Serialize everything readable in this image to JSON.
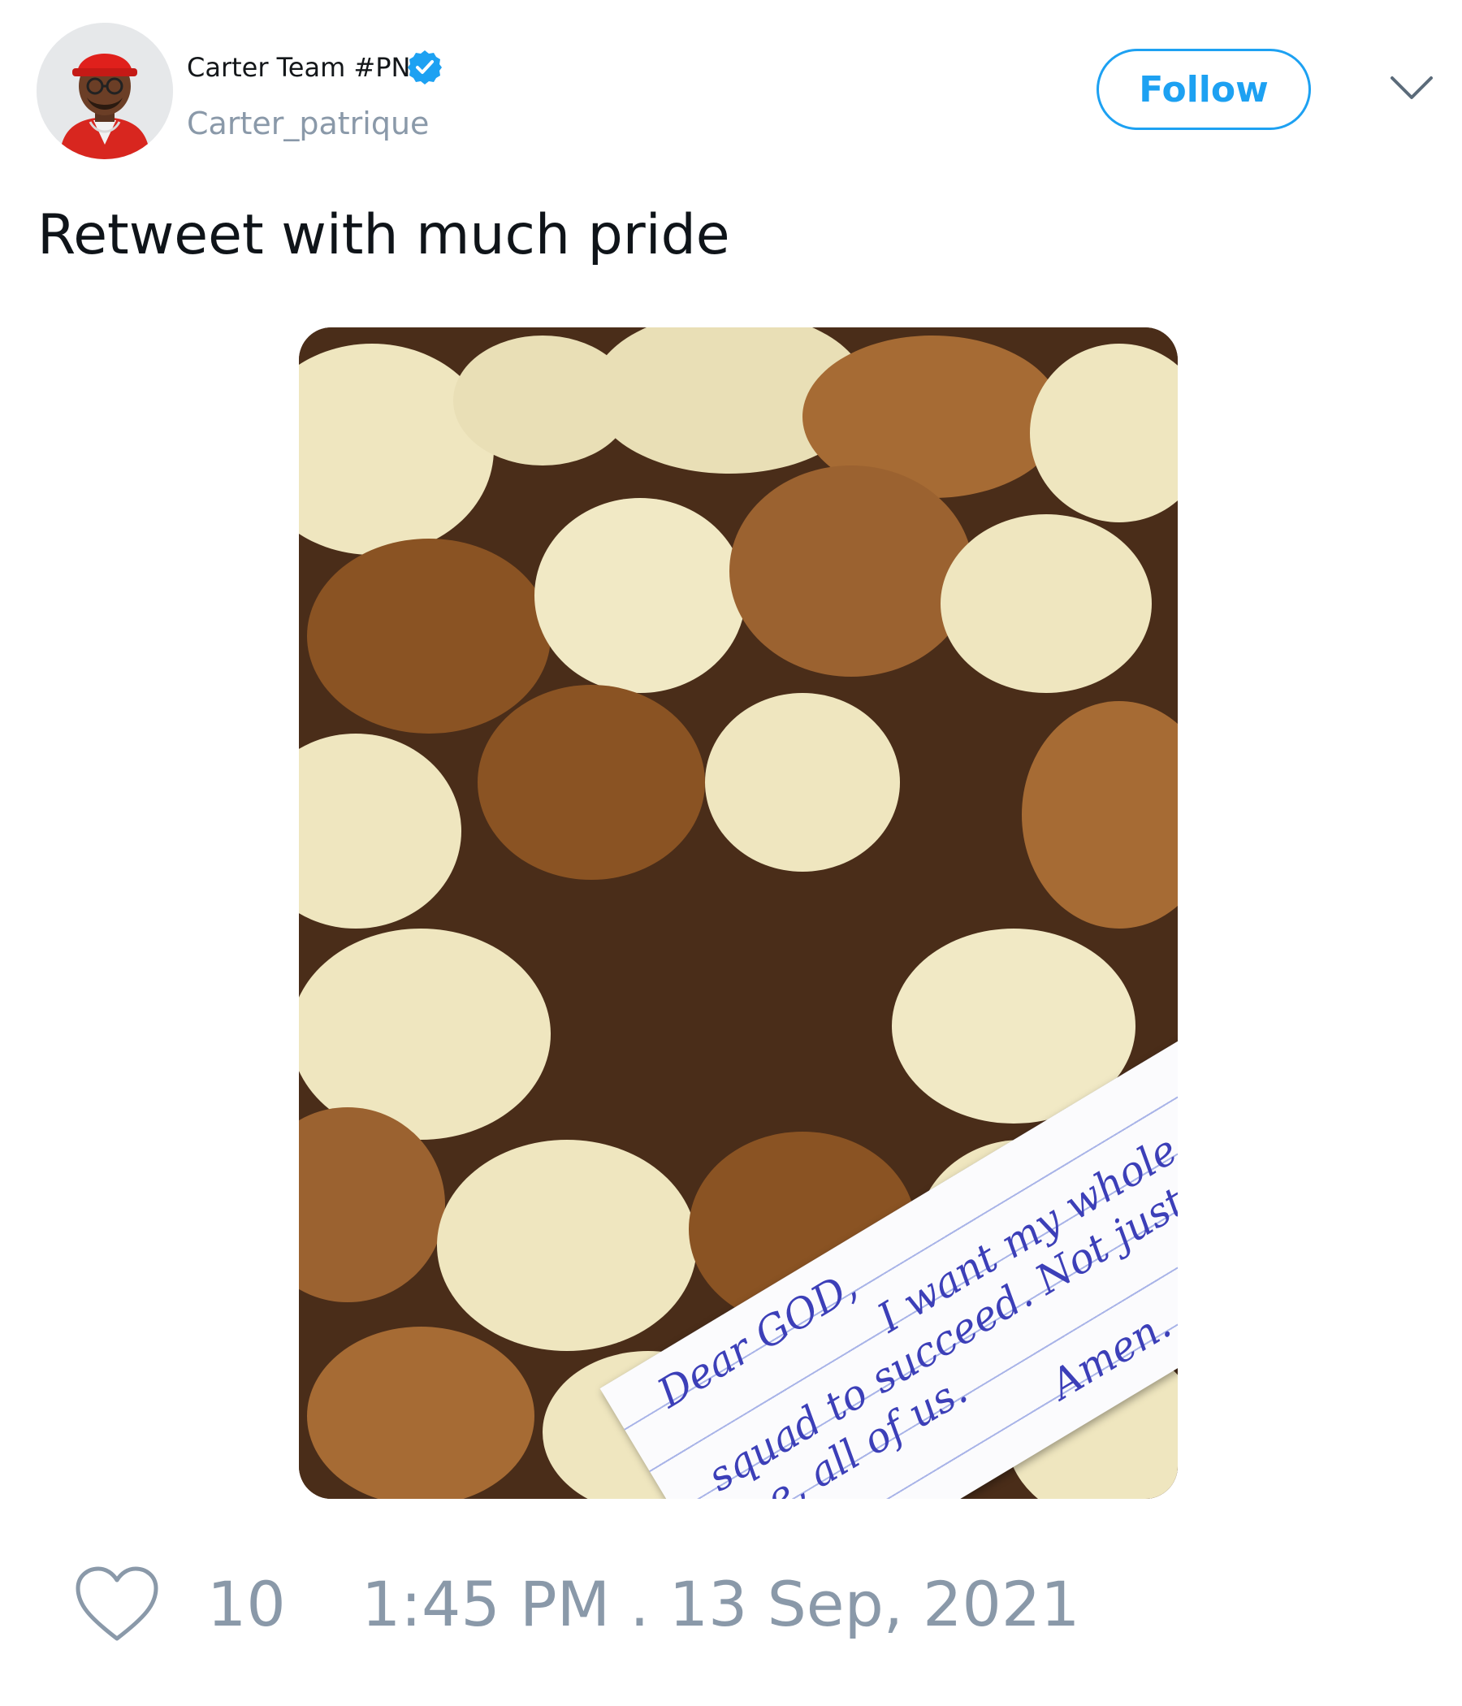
{
  "author": {
    "display_name": "Carter Team #PN",
    "handle": "Carter_patrique",
    "verified": true,
    "avatar_icon": "avatar-cartoon-red-cap"
  },
  "follow_button": {
    "label": "Follow"
  },
  "menu": {
    "icon": "chevron-down-icon"
  },
  "tweet": {
    "text": "Retweet with much pride",
    "photo": {
      "note_lines": [
        "Dear GOD,",
        "I want my whole",
        "squad to succeed. Not just",
        "me, all of us.",
        "Amen."
      ]
    }
  },
  "stats": {
    "likes": "10",
    "timestamp": "1:45 PM . 13 Sep, 2021"
  },
  "colors": {
    "accent": "#1da1f2",
    "muted": "#8a99a9",
    "ink": "#3c3fb8"
  }
}
